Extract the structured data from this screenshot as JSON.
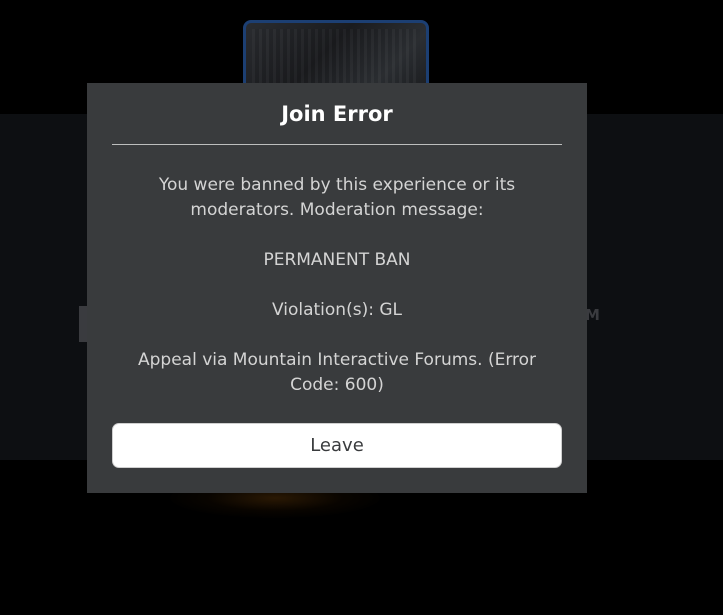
{
  "dialog": {
    "title": "Join Error",
    "message_lines": [
      "You were banned by this experience or its moderators. Moderation message:",
      "PERMANENT BAN",
      "Violation(s): GL",
      "Appeal via Mountain Interactive Forums. (Error Code: 600)"
    ],
    "leave_label": "Leave"
  },
  "colors": {
    "modal_background": "#393b3d",
    "title_text": "#ffffff",
    "body_text": "#d4d4d4",
    "button_background": "#ffffff",
    "button_text": "#393b3d",
    "page_background": "#000000"
  }
}
